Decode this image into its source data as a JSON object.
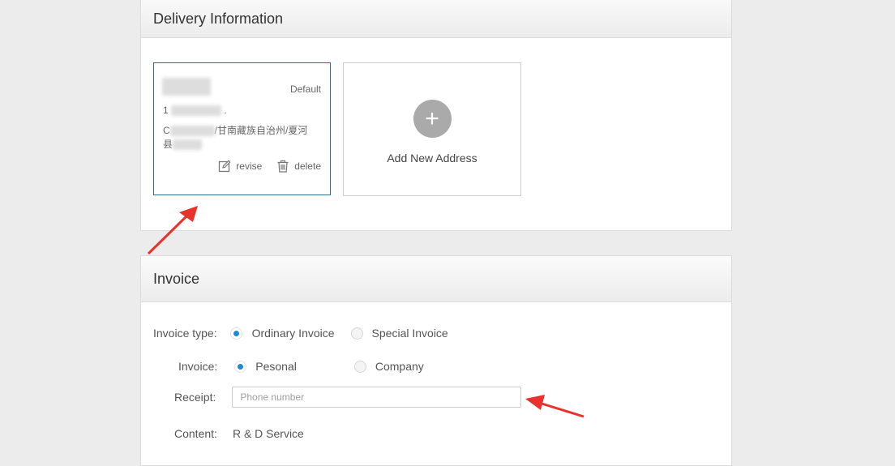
{
  "delivery": {
    "title": "Delivery Information",
    "address_card": {
      "badge": "Default",
      "phone_prefix": "1",
      "phone_suffix": ".",
      "region_prefix": "C",
      "region_text": "/甘南藏族自治州/夏河",
      "county_prefix": "县",
      "revise_label": "revise",
      "delete_label": "delete"
    },
    "add_label": "Add New Address"
  },
  "invoice": {
    "title": "Invoice",
    "type_label": "Invoice type:",
    "type_options": [
      "Ordinary Invoice",
      "Special Invoice"
    ],
    "type_selected": "Ordinary Invoice",
    "holder_label": "Invoice:",
    "holder_options": [
      "Pesonal",
      "Company"
    ],
    "holder_selected": "Pesonal",
    "receipt_label": "Receipt:",
    "receipt_placeholder": "Phone number",
    "content_label": "Content:",
    "content_value": "R & D Service"
  },
  "colors": {
    "accent": "#1e8ad8",
    "card_border": "#2f6f8f",
    "annotation_arrow": "#e8322c"
  }
}
